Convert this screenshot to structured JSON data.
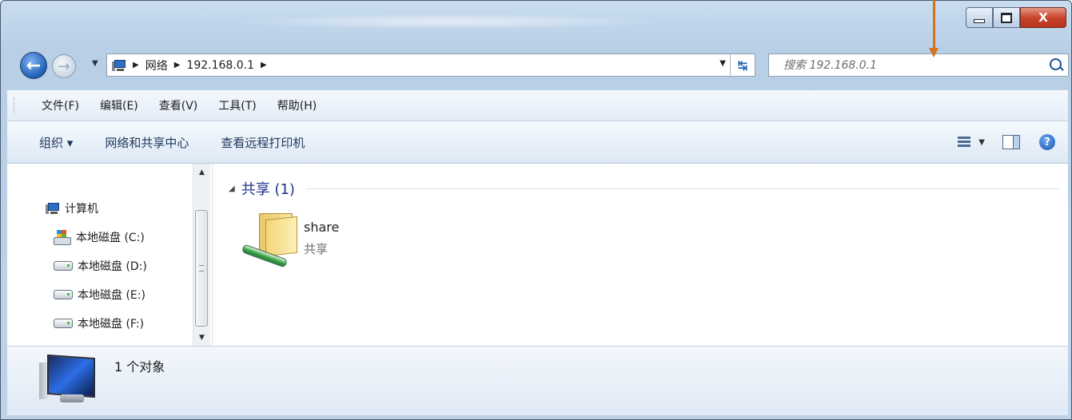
{
  "window": {
    "caption_buttons": {
      "minimize": "–",
      "maximize": "□",
      "close": "X"
    }
  },
  "address": {
    "crumbs": [
      "网络",
      "192.168.0.1"
    ],
    "search_placeholder": "搜索 192.168.0.1"
  },
  "menubar": {
    "items": [
      "文件(F)",
      "编辑(E)",
      "查看(V)",
      "工具(T)",
      "帮助(H)"
    ]
  },
  "commandbar": {
    "organize": "组织 ▾",
    "network_sharing_center": "网络和共享中心",
    "view_remote_printers": "查看远程打印机",
    "help": "?"
  },
  "navpane": {
    "computer": "计算机",
    "drives": [
      "本地磁盘 (C:)",
      "本地磁盘 (D:)",
      "本地磁盘 (E:)",
      "本地磁盘 (F:)"
    ]
  },
  "content": {
    "group_label": "共享 (1)",
    "items": [
      {
        "name": "share",
        "type": "共享"
      }
    ]
  },
  "details": {
    "object_count": "1 个对象"
  },
  "icons": {
    "back": "back-arrow-icon",
    "forward": "forward-arrow-icon",
    "computer": "computer-icon",
    "refresh": "refresh-icon",
    "search": "search-icon",
    "folder": "shared-folder-icon",
    "drive": "hard-drive-icon",
    "monitor": "monitor-icon"
  },
  "colors": {
    "annotation_arrow": "#d6721c",
    "group_label": "#1e3287",
    "command_text": "#1e395b"
  }
}
